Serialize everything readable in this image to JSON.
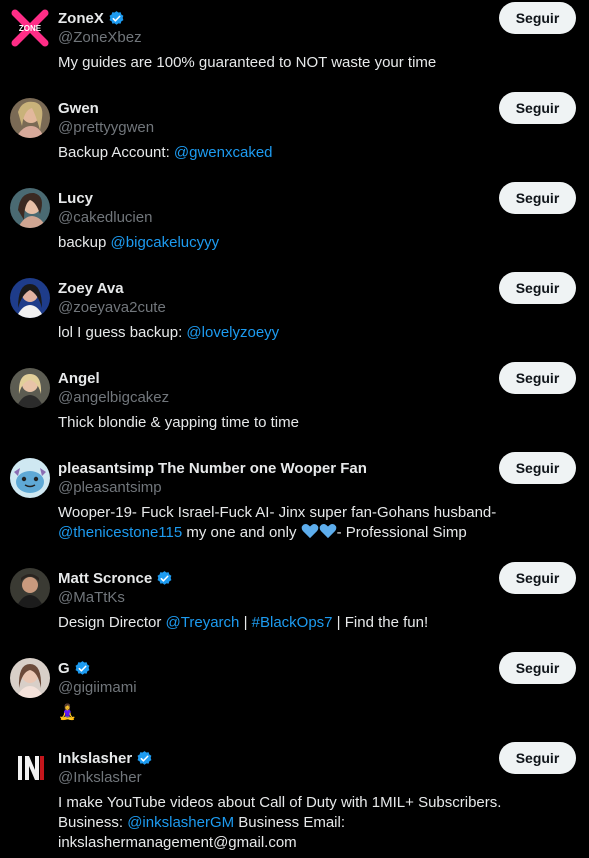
{
  "follow_label": "Seguir",
  "users": [
    {
      "name": "ZoneX",
      "handle": "@ZoneXbez",
      "verified": true,
      "bio": {
        "before": "My guides are 100% guaranteed to NOT waste your time"
      }
    },
    {
      "name": "Gwen",
      "handle": "@prettyygwen",
      "verified": false,
      "bio": {
        "before": "Backup Account: ",
        "link": "@gwenxcaked"
      }
    },
    {
      "name": "Lucy",
      "handle": "@cakedlucien",
      "verified": false,
      "bio": {
        "before": "backup ",
        "link": "@bigcakelucyyy"
      }
    },
    {
      "name": "Zoey Ava",
      "handle": "@zoeyava2cute",
      "verified": false,
      "bio": {
        "before": "lol I guess backup: ",
        "link": "@lovelyzoeyy"
      }
    },
    {
      "name": "Angel",
      "handle": "@angelbigcakez",
      "verified": false,
      "bio": {
        "before": "Thick blondie & yapping time to time"
      }
    },
    {
      "name": "pleasantsimp The Number one Wooper Fan",
      "handle": "@pleasantsimp",
      "verified": false,
      "bio": {
        "line1": "Wooper-19- Fuck Israel-Fuck AI- Jinx super fan-Gohans husband-",
        "link": "@thenicestone115",
        "mid": " my one and only ",
        "after": "- Professional Simp"
      }
    },
    {
      "name": "Matt Scronce",
      "handle": "@MaTtKs",
      "verified": true,
      "bio": {
        "before": "Design Director ",
        "link1": "@Treyarch",
        "sep": " | ",
        "link2": "#BlackOps7",
        "after": " | Find the fun!"
      }
    },
    {
      "name": "G",
      "handle": "@gigiimami",
      "verified": true,
      "bio": {
        "emoji": "🧘‍♀️"
      }
    },
    {
      "name": "Inkslasher",
      "handle": "@Inkslasher",
      "verified": true,
      "bio": {
        "line1": "I make YouTube videos about Call of Duty with 1MIL+ Subscribers.",
        "line2_before": "Business: ",
        "link": "@inkslasherGM",
        "line2_after": " Business Email:",
        "line3": "inkslashermanagement@gmail.com"
      }
    }
  ],
  "colors": {
    "background": "#000000",
    "text": "#e7e9ea",
    "muted": "#71767b",
    "link": "#1d9bf0",
    "verified": "#1d9bf0",
    "button_bg": "#eff3f4"
  }
}
